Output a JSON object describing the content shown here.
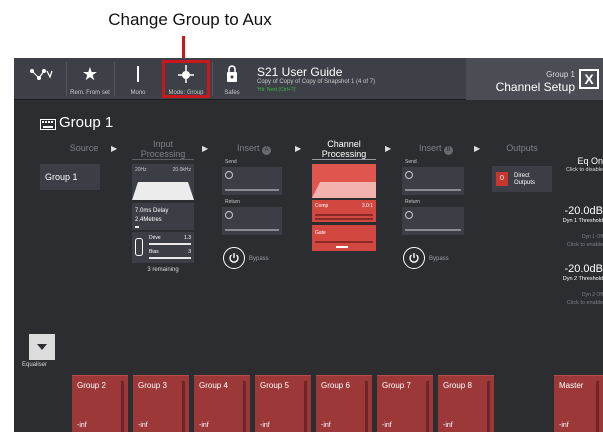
{
  "caption": "Change Group to Aux",
  "toolbar": {
    "buttons": [
      {
        "label": "",
        "icon": "network-icon"
      },
      {
        "label": "Rem. From set",
        "icon": "star-icon"
      },
      {
        "label": "Mono",
        "icon": "mono-icon"
      },
      {
        "label": "Mode: Group",
        "icon": "mode-group-icon"
      },
      {
        "label": "Safes",
        "icon": "lock-icon"
      }
    ],
    "title": "S21 User Guide",
    "subtitle": "Copy of Copy of Copy of Snapshot 1 (4 of 7)",
    "subtitle2": "'Hit: Next (Ctrl+?)'",
    "channel_small": "Group 1",
    "channel_big": "Channel Setup",
    "close": "X"
  },
  "main": {
    "title": "Group 1",
    "sections": {
      "source": "Source",
      "input_processing": "Input Processing",
      "insert_a": "Insert",
      "insert_a_badge": "A",
      "channel_processing": "Channel Processing",
      "insert_b": "Insert",
      "insert_b_badge": "B",
      "outputs": "Outputs"
    },
    "source_value": "Group 1",
    "input": {
      "filter_left": "20Hz",
      "filter_right": "20.0kHz",
      "delay": "7.0ms Delay",
      "delay_m": "2.4Metres",
      "drive_label": "Drive",
      "drive_value": "1.3",
      "bias_label": "Bias",
      "bias_value": "3",
      "remaining": "3 remaining"
    },
    "insert_a": {
      "send": "Send",
      "return": "Return",
      "bypass": "Bypass"
    },
    "insert_b": {
      "send": "Send",
      "return": "Return",
      "bypass": "Bypass"
    },
    "channel": {
      "comp": "Comp",
      "comp_ratio": "3.0:1",
      "gate": "Gate"
    },
    "outputs": {
      "badge": "0",
      "label1": "Direct",
      "label2": "Outputs"
    },
    "right": {
      "eq_on": "Eq On",
      "eq_sub": "Click to disable",
      "dyn1_value": "-20.0dB",
      "dyn1_label": "Dyn 1 Threshold",
      "dyn1_off": "Dyn 1 Off",
      "dyn1_enable": "Click to enable",
      "dyn2_value": "-20.0dB",
      "dyn2_label": "Dyn 2 Threshold",
      "dyn2_off": "Dyn 2 Off",
      "dyn2_enable": "Click to enable"
    },
    "equaliser": "Equaliser"
  },
  "faders": [
    {
      "name": "Group 2",
      "value": "-inf"
    },
    {
      "name": "Group 3",
      "value": "-inf"
    },
    {
      "name": "Group 4",
      "value": "-inf"
    },
    {
      "name": "Group 5",
      "value": "-inf"
    },
    {
      "name": "Group 6",
      "value": "-inf"
    },
    {
      "name": "Group 7",
      "value": "-inf"
    },
    {
      "name": "Group 8",
      "value": "-inf"
    },
    {
      "name": "Master",
      "value": "-inf"
    }
  ],
  "colors": {
    "accent_red": "#c8171d",
    "processing_red": "#e0564f",
    "fader_red": "#9c3838"
  }
}
